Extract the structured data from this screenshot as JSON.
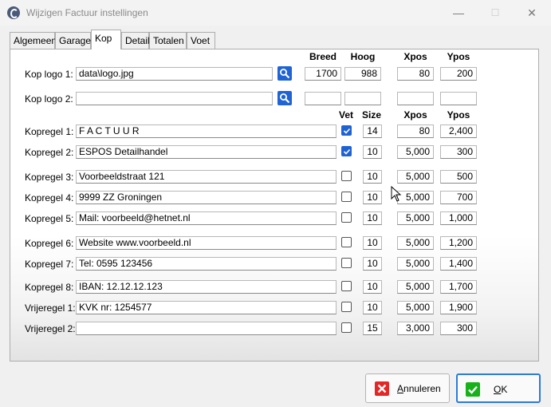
{
  "window": {
    "title": "Wijzigen Factuur instellingen",
    "minimize": "—",
    "maximize": "☐",
    "close": "✕"
  },
  "tabs": [
    {
      "label": "Algemeen",
      "active": false
    },
    {
      "label": "Garage",
      "active": false
    },
    {
      "label": "Kop",
      "active": true
    },
    {
      "label": "Detail",
      "active": false
    },
    {
      "label": "Totalen",
      "active": false
    },
    {
      "label": "Voet",
      "active": false
    }
  ],
  "logo_headers": {
    "breed": "Breed",
    "hoog": "Hoog",
    "xpos": "Xpos",
    "ypos": "Ypos"
  },
  "logos": [
    {
      "label": "Kop logo 1:",
      "path": "data\\logo.jpg",
      "breed": "1700",
      "hoog": "988",
      "xpos": "80",
      "ypos": "200"
    },
    {
      "label": "Kop logo 2:",
      "path": "",
      "breed": "",
      "hoog": "",
      "xpos": "",
      "ypos": ""
    }
  ],
  "line_headers": {
    "vet": "Vet",
    "size": "Size",
    "xpos": "Xpos",
    "ypos": "Ypos"
  },
  "lines": [
    {
      "label": "Kopregel 1:",
      "text": "F A C T U U R",
      "vet": true,
      "size": "14",
      "xpos": "80",
      "ypos": "2,400"
    },
    {
      "label": "Kopregel 2:",
      "text": "ESPOS Detailhandel",
      "vet": true,
      "size": "10",
      "xpos": "5,000",
      "ypos": "300"
    },
    {
      "label": "Kopregel 3:",
      "text": "Voorbeeldstraat 121",
      "vet": false,
      "size": "10",
      "xpos": "5,000",
      "ypos": "500"
    },
    {
      "label": "Kopregel 4:",
      "text": "9999 ZZ  Groningen",
      "vet": false,
      "size": "10",
      "xpos": "5,000",
      "ypos": "700"
    },
    {
      "label": "Kopregel 5:",
      "text": "Mail: voorbeeld@hetnet.nl",
      "vet": false,
      "size": "10",
      "xpos": "5,000",
      "ypos": "1,000"
    },
    {
      "label": "Kopregel 6:",
      "text": "Website www.voorbeeld.nl",
      "vet": false,
      "size": "10",
      "xpos": "5,000",
      "ypos": "1,200"
    },
    {
      "label": "Kopregel 7:",
      "text": "Tel: 0595 123456",
      "vet": false,
      "size": "10",
      "xpos": "5,000",
      "ypos": "1,400"
    },
    {
      "label": "Kopregel 8:",
      "text": "IBAN: 12.12.12.123",
      "vet": false,
      "size": "10",
      "xpos": "5,000",
      "ypos": "1,700"
    },
    {
      "label": "Vrijeregel 1:",
      "text": "KVK nr: 1254577",
      "vet": false,
      "size": "10",
      "xpos": "5,000",
      "ypos": "1,900"
    },
    {
      "label": "Vrijeregel 2:",
      "text": "",
      "vet": false,
      "size": "15",
      "xpos": "3,000",
      "ypos": "300"
    }
  ],
  "buttons": {
    "cancel": {
      "label": "Annuleren",
      "icon": "red-x-icon",
      "color": "#e32626"
    },
    "ok": {
      "label": "OK",
      "icon": "green-check-icon",
      "color": "#17b11a"
    }
  }
}
